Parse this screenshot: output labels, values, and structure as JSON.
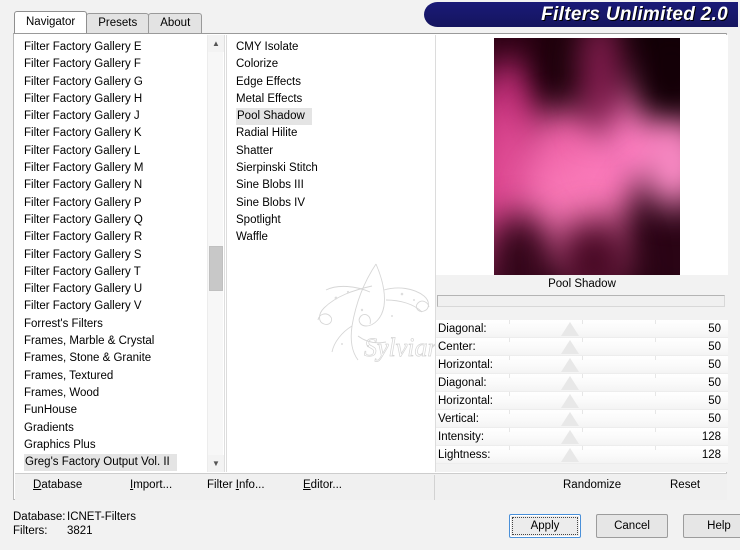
{
  "window": {
    "title": "Filters Unlimited 2.0"
  },
  "tabs": [
    {
      "label": "Navigator",
      "active": true
    },
    {
      "label": "Presets",
      "active": false
    },
    {
      "label": "About",
      "active": false
    }
  ],
  "categories": {
    "items": [
      "Filter Factory Gallery E",
      "Filter Factory Gallery F",
      "Filter Factory Gallery G",
      "Filter Factory Gallery H",
      "Filter Factory Gallery J",
      "Filter Factory Gallery K",
      "Filter Factory Gallery L",
      "Filter Factory Gallery M",
      "Filter Factory Gallery N",
      "Filter Factory Gallery P",
      "Filter Factory Gallery Q",
      "Filter Factory Gallery R",
      "Filter Factory Gallery S",
      "Filter Factory Gallery T",
      "Filter Factory Gallery U",
      "Filter Factory Gallery V",
      "Forrest's Filters",
      "Frames, Marble & Crystal",
      "Frames, Stone & Granite",
      "Frames, Textured",
      "Frames, Wood",
      "FunHouse",
      "Gradients",
      "Graphics Plus",
      "Greg's Factory Output Vol. II"
    ],
    "selected": "Greg's Factory Output Vol. II",
    "scroll_up_icon": "chevron-up-icon",
    "scroll_down_icon": "chevron-down-icon"
  },
  "filters": {
    "items": [
      "CMY Isolate",
      "Colorize",
      "Edge Effects",
      "Metal Effects",
      "Pool Shadow",
      "Radial Hilite",
      "Shatter",
      "Sierpinski Stitch",
      "Sine Blobs III",
      "Sine Blobs IV",
      "Spotlight",
      "Waffle"
    ],
    "selected": "Pool Shadow"
  },
  "preview": {
    "filter_name": "Pool Shadow",
    "watermark": "Sylviane"
  },
  "parameters": [
    {
      "label": "Diagonal:",
      "value": "50",
      "pos": 50
    },
    {
      "label": "Center:",
      "value": "50",
      "pos": 50
    },
    {
      "label": "Horizontal:",
      "value": "50",
      "pos": 50
    },
    {
      "label": "Diagonal:",
      "value": "50",
      "pos": 50
    },
    {
      "label": "Horizontal:",
      "value": "50",
      "pos": 50
    },
    {
      "label": "Vertical:",
      "value": "50",
      "pos": 50
    },
    {
      "label": "Intensity:",
      "value": "128",
      "pos": 50
    },
    {
      "label": "Lightness:",
      "value": "128",
      "pos": 50
    }
  ],
  "actionbar": {
    "database": {
      "pre": "",
      "accel": "D",
      "post": "atabase"
    },
    "import": {
      "pre": "",
      "accel": "I",
      "post": "mport..."
    },
    "filter_info": {
      "pre": "Filter ",
      "accel": "I",
      "post": "nfo..."
    },
    "editor": {
      "pre": "",
      "accel": "E",
      "post": "ditor..."
    },
    "randomize": "Randomize",
    "reset": "Reset"
  },
  "status": {
    "database_key": "Database:",
    "database_value": "ICNET-Filters",
    "filters_key": "Filters:",
    "filters_value": "3821"
  },
  "buttons": {
    "apply": "Apply",
    "cancel": "Cancel",
    "help": "Help"
  },
  "colors": {
    "banner": "#191970",
    "accent": "#4a90d9",
    "selection": "#e4e4e4"
  }
}
